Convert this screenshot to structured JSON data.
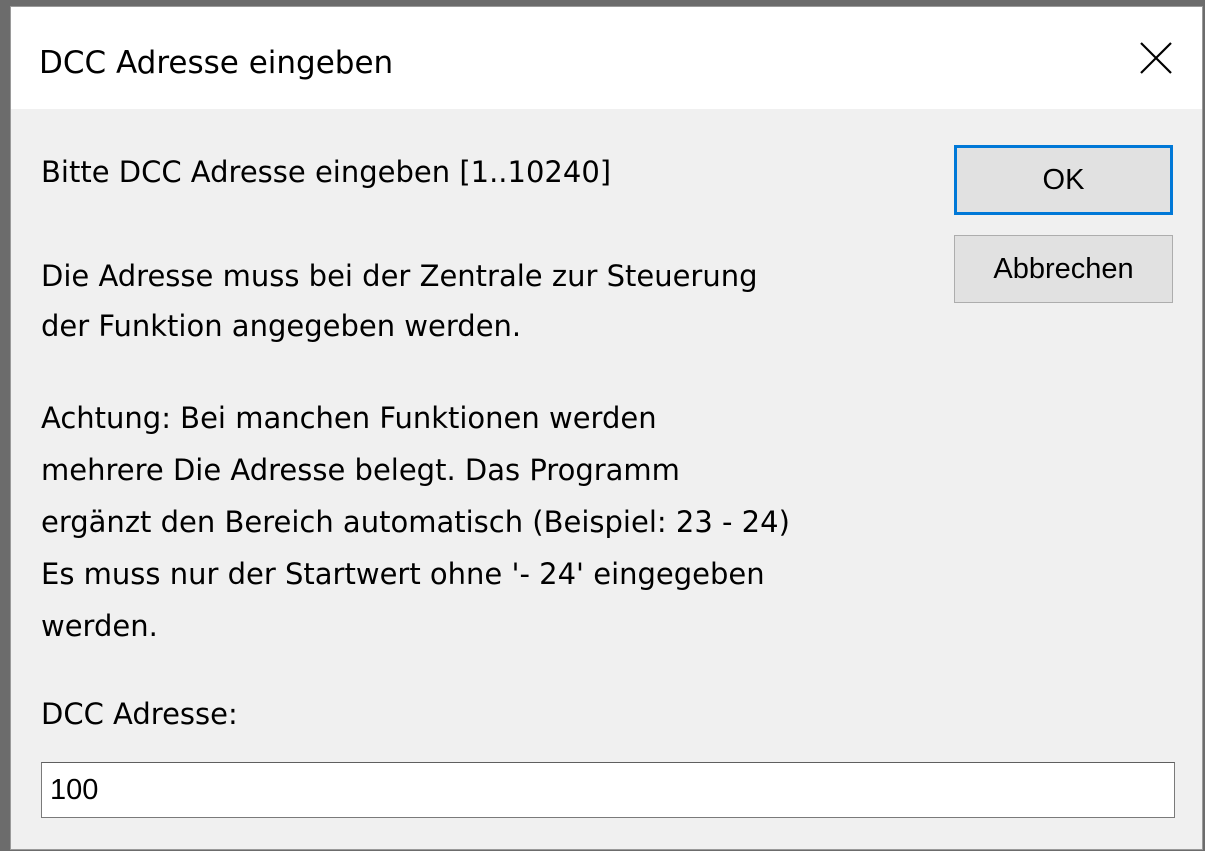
{
  "window": {
    "title": "DCC Adresse eingeben"
  },
  "dialog": {
    "prompt": "Bitte DCC Adresse eingeben [1..10240]",
    "info_lines": [
      "Die Adresse muss bei der Zentrale zur Steuerung",
      "der Funktion angegeben werden."
    ],
    "warning_lines": [
      "Achtung: Bei manchen Funktionen werden",
      "mehrere Die Adresse belegt. Das Programm",
      "ergänzt den Bereich automatisch (Beispiel: 23 - 24)",
      "Es muss nur der Startwert ohne '- 24' eingegeben",
      "werden."
    ],
    "field_label": "DCC Adresse:",
    "field_value": "100"
  },
  "buttons": {
    "ok_label": "OK",
    "cancel_label": "Abbrechen"
  },
  "icons": {
    "close": "close-icon"
  }
}
